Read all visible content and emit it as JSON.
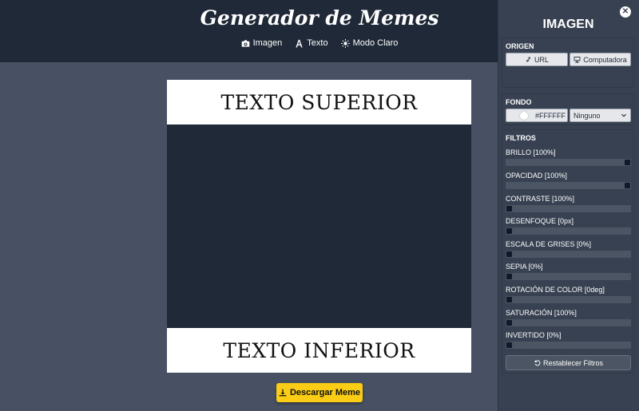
{
  "header": {
    "title": "Generador de Memes",
    "nav": [
      {
        "label": "Imagen",
        "icon": "camera-icon"
      },
      {
        "label": "Texto",
        "icon": "font-icon"
      },
      {
        "label": "Modo Claro",
        "icon": "sun-icon"
      }
    ]
  },
  "meme": {
    "top_text": "TEXTO SUPERIOR",
    "bottom_text": "TEXTO INFERIOR",
    "image_color": "#1f2937",
    "text_bg_color": "#FFFFFF"
  },
  "download": {
    "label": "Descargar Meme",
    "icon": "download-icon"
  },
  "panel": {
    "title": "IMAGEN",
    "close_icon": "close-icon",
    "origen": {
      "label": "ORIGEN",
      "url_label": "URL",
      "computer_label": "Computadora"
    },
    "fondo": {
      "label": "FONDO",
      "color_value": "#FFFFFF",
      "blend_selected": "Ninguno"
    },
    "filtros": {
      "label": "FILTROS",
      "items": [
        {
          "label": "BRILLO [100%]",
          "value": 1.0
        },
        {
          "label": "OPACIDAD [100%]",
          "value": 1.0
        },
        {
          "label": "CONTRASTE [100%]",
          "value": 0.0
        },
        {
          "label": "DESENFOQUE [0px]",
          "value": 0.0
        },
        {
          "label": "ESCALA DE GRISES [0%]",
          "value": 0.0
        },
        {
          "label": "SEPIA [0%]",
          "value": 0.0
        },
        {
          "label": "ROTACIÓN DE COLOR [0deg]",
          "value": 0.0
        },
        {
          "label": "SATURACIÓN [100%]",
          "value": 0.0
        },
        {
          "label": "INVERTIDO [0%]",
          "value": 0.0
        }
      ],
      "reset_label": "Restablecer Filtros"
    }
  },
  "colors": {
    "header_bg": "#1f2937",
    "page_bg": "#475163",
    "panel_bg": "#374151",
    "accent": "#facc15"
  }
}
